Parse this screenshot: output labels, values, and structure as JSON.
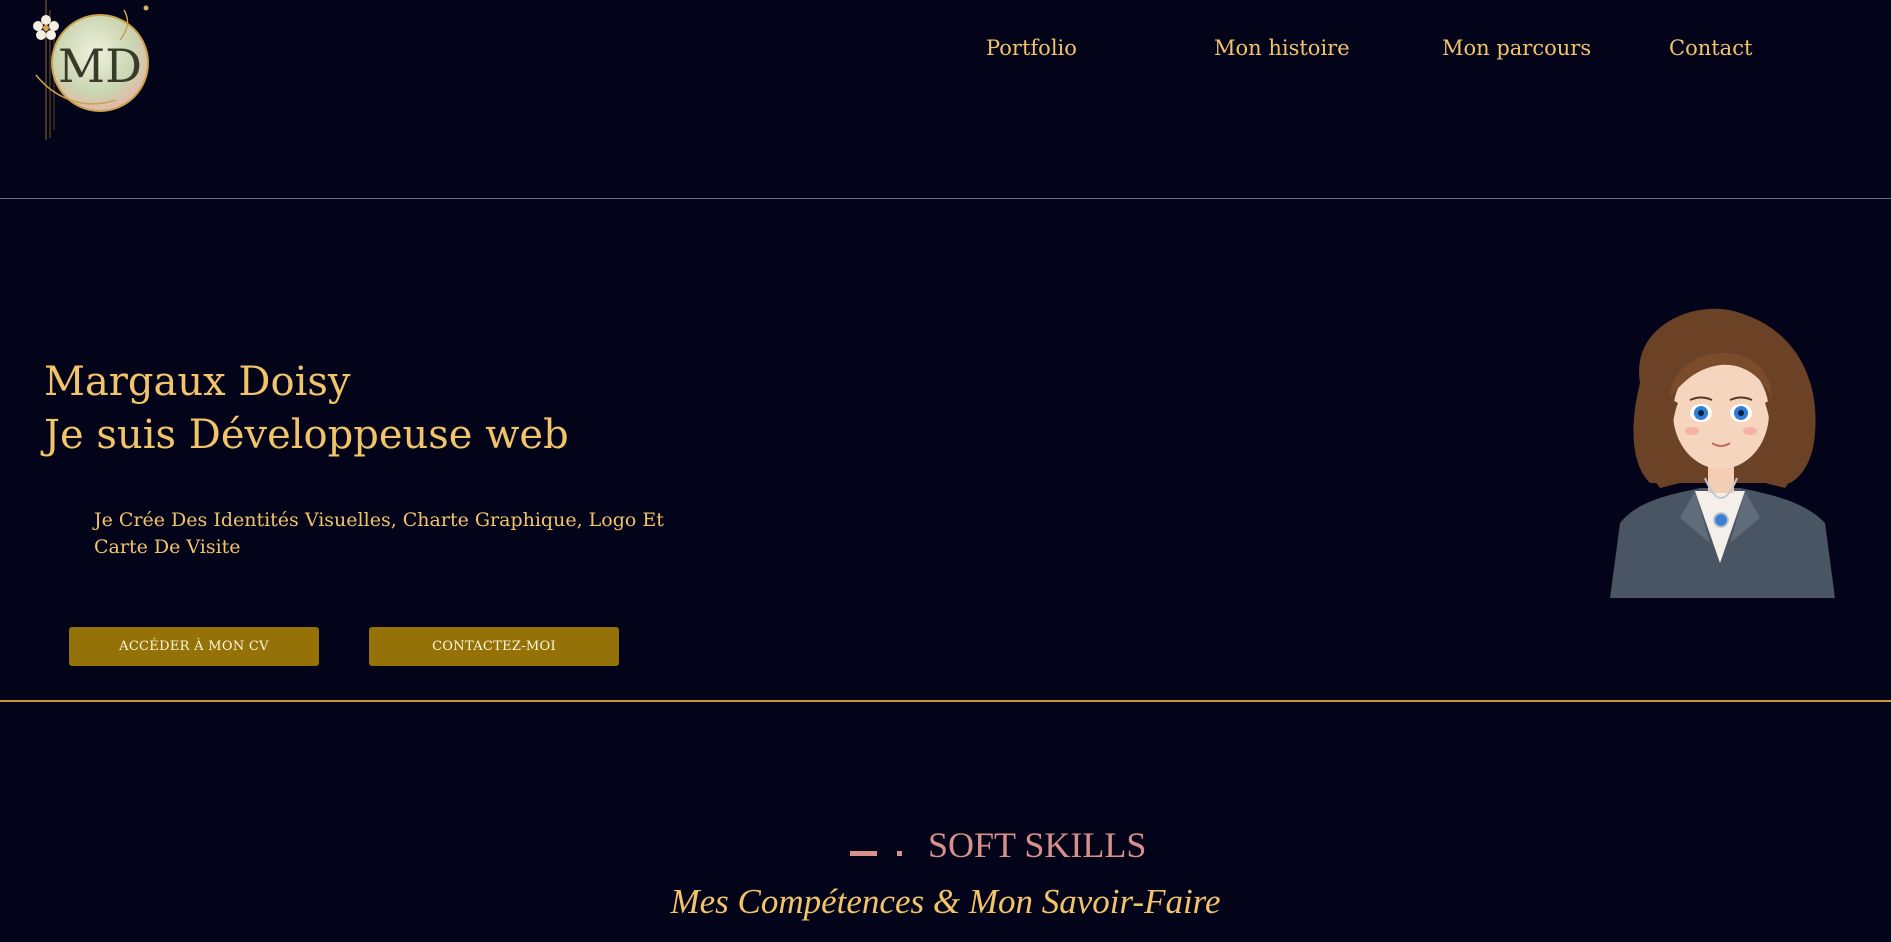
{
  "brand": {
    "logo_text": "MD"
  },
  "nav": {
    "items": [
      {
        "label": "Portfolio"
      },
      {
        "label": "Mon histoire"
      },
      {
        "label": "Mon parcours"
      },
      {
        "label": "Contact"
      }
    ]
  },
  "hero": {
    "title_line1": "Margaux Doisy",
    "title_line2": "Je suis Développeuse web",
    "description": "Je Crée Des Identités Visuelles, Charte Graphique, Logo Et Carte De Visite",
    "cv_button": "ACCÉDER À MON CV",
    "contact_button": "CONTACTEZ-MOI"
  },
  "skills": {
    "label": "SOFT SKILLS",
    "subtitle": "Mes Compétences & Mon Savoir-Faire"
  },
  "colors": {
    "background": "#03031a",
    "gold_text": "#f2c46a",
    "button_bg": "#947208",
    "accent_pink": "#d8908a",
    "divider_gold": "#c9962f"
  }
}
